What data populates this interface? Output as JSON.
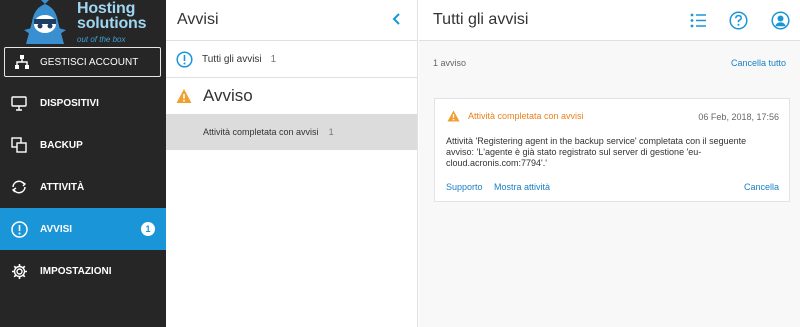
{
  "brand": {
    "name_line1": "Hosting",
    "name_line2": "solutions",
    "tagline": "out of the box",
    "color": "#9fd6f2"
  },
  "sidebar": {
    "account_button": "GESTISCI ACCOUNT",
    "items": [
      {
        "label": "DISPOSITIVI",
        "icon": "monitor-icon"
      },
      {
        "label": "BACKUP",
        "icon": "backup-icon"
      },
      {
        "label": "ATTIVITÀ",
        "icon": "activity-icon"
      },
      {
        "label": "AVVISI",
        "icon": "alert-circle-icon",
        "badge": "1",
        "active": true
      },
      {
        "label": "IMPOSTAZIONI",
        "icon": "gear-icon"
      }
    ],
    "active_color": "#1a96d8",
    "background": "#262626"
  },
  "middle": {
    "title": "Avvisi",
    "all_alerts": {
      "label": "Tutti gli avvisi",
      "count": "1"
    },
    "group": {
      "title": "Avviso",
      "items": [
        {
          "label": "Attività completata con avvisi",
          "count": "1"
        }
      ]
    }
  },
  "right": {
    "title": "Tutti gli avvisi",
    "summary_count": "1 avviso",
    "clear_all": "Cancella tutto",
    "alert": {
      "title": "Attività completata con avvisi",
      "date": "06 Feb, 2018, 17:56",
      "body_line1": "Attività 'Registering agent in the backup service' completata con il seguente",
      "body_line2": "avviso: 'L'agente è già stato registrato sul server di gestione 'eu-",
      "body_line3": "cloud.acronis.com:7794'.'",
      "support_link": "Supporto",
      "show_activity_link": "Mostra attività",
      "cancel_link": "Cancella",
      "warning_color": "#e8821c"
    }
  }
}
